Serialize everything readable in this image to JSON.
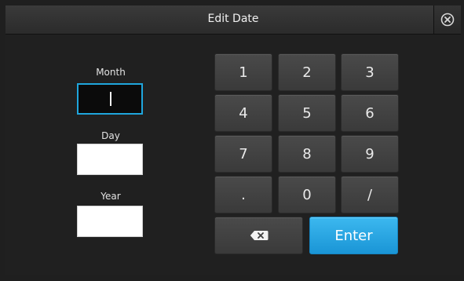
{
  "dialog": {
    "title": "Edit Date"
  },
  "fields": {
    "month": {
      "label": "Month",
      "value": ""
    },
    "day": {
      "label": "Day",
      "value": ""
    },
    "year": {
      "label": "Year",
      "value": ""
    }
  },
  "keypad": {
    "rows": [
      [
        "1",
        "2",
        "3"
      ],
      [
        "4",
        "5",
        "6"
      ],
      [
        "7",
        "8",
        "9"
      ],
      [
        ".",
        "0",
        "/"
      ]
    ],
    "backspace_icon": "backspace-icon",
    "enter_label": "Enter"
  },
  "colors": {
    "accent": "#1fa6dd",
    "enter": "#2aa8e6"
  }
}
